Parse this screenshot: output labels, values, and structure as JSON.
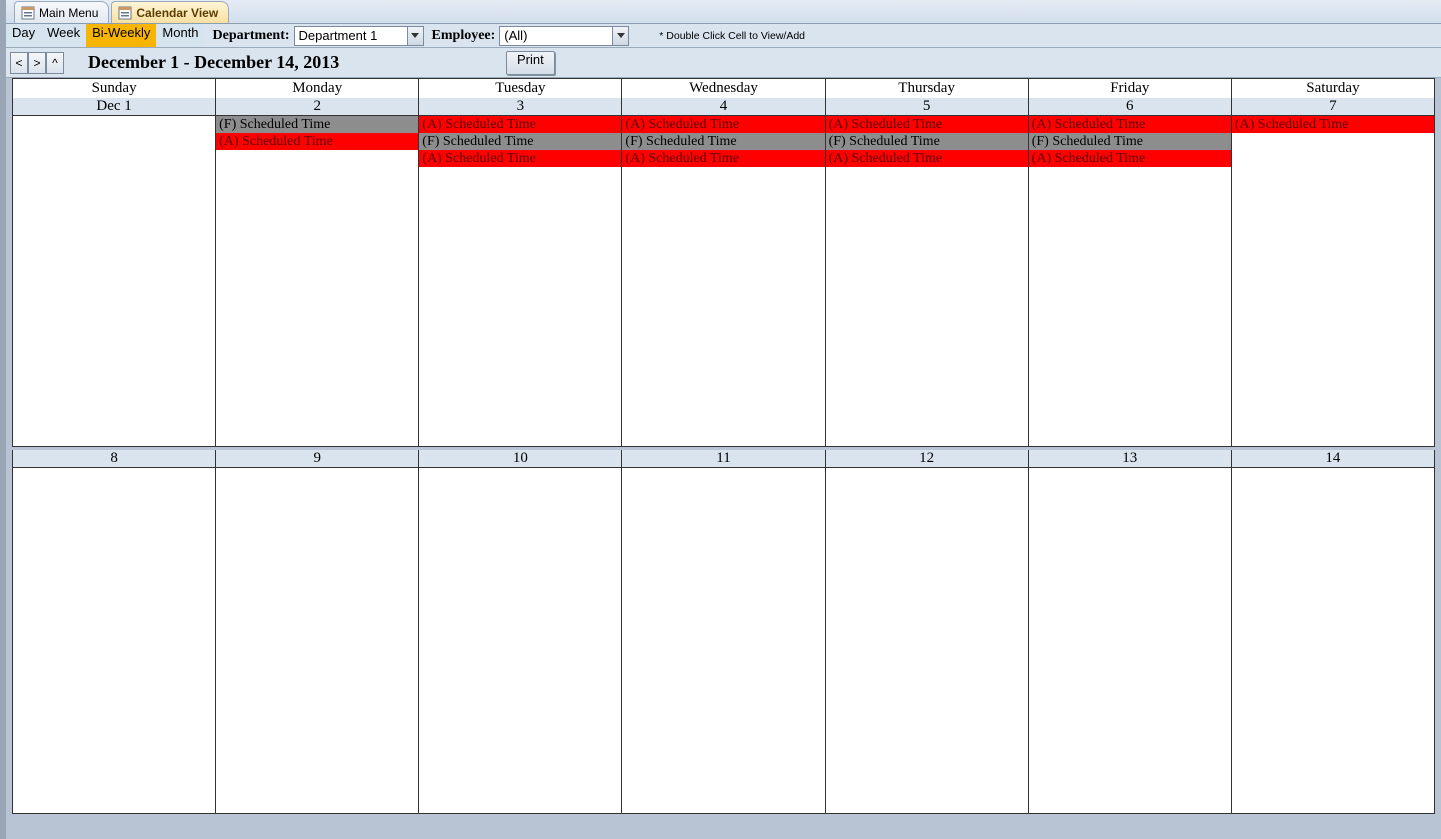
{
  "tabs": {
    "main": "Main Menu",
    "calendar": "Calendar View"
  },
  "views": {
    "day": "Day",
    "week": "Week",
    "biweekly": "Bi-Weekly",
    "month": "Month"
  },
  "filters": {
    "dept_label": "Department:",
    "dept_value": "Department 1",
    "emp_label": "Employee:",
    "emp_value": "(All)"
  },
  "hint": "* Double Click Cell to View/Add",
  "nav": {
    "prev": "<",
    "next": ">",
    "up": "^",
    "range": "December 1 - December 14, 2013",
    "print": "Print"
  },
  "dayheaders": [
    "Sunday",
    "Monday",
    "Tuesday",
    "Wednesday",
    "Thursday",
    "Friday",
    "Saturday"
  ],
  "week1_dates": [
    "Dec 1",
    "2",
    "3",
    "4",
    "5",
    "6",
    "7"
  ],
  "week2_dates": [
    "8",
    "9",
    "10",
    "11",
    "12",
    "13",
    "14"
  ],
  "week1_events": [
    [],
    [
      {
        "t": "(F) Scheduled Time",
        "c": "gray"
      },
      {
        "t": "(A) Scheduled Time",
        "c": "red"
      }
    ],
    [
      {
        "t": "(A) Scheduled Time",
        "c": "red"
      },
      {
        "t": "(F) Scheduled Time",
        "c": "gray"
      },
      {
        "t": "(A) Scheduled Time",
        "c": "red"
      }
    ],
    [
      {
        "t": "(A) Scheduled Time",
        "c": "red"
      },
      {
        "t": "(F) Scheduled Time",
        "c": "gray"
      },
      {
        "t": "(A) Scheduled Time",
        "c": "red"
      }
    ],
    [
      {
        "t": "(A) Scheduled Time",
        "c": "red"
      },
      {
        "t": "(F) Scheduled Time",
        "c": "gray"
      },
      {
        "t": "(A) Scheduled Time",
        "c": "red"
      }
    ],
    [
      {
        "t": "(A) Scheduled Time",
        "c": "red"
      },
      {
        "t": "(F) Scheduled Time",
        "c": "gray"
      },
      {
        "t": "(A) Scheduled Time",
        "c": "red"
      }
    ],
    [
      {
        "t": "(A) Scheduled Time",
        "c": "red"
      }
    ]
  ],
  "week2_events": [
    [],
    [],
    [],
    [],
    [],
    [],
    []
  ]
}
